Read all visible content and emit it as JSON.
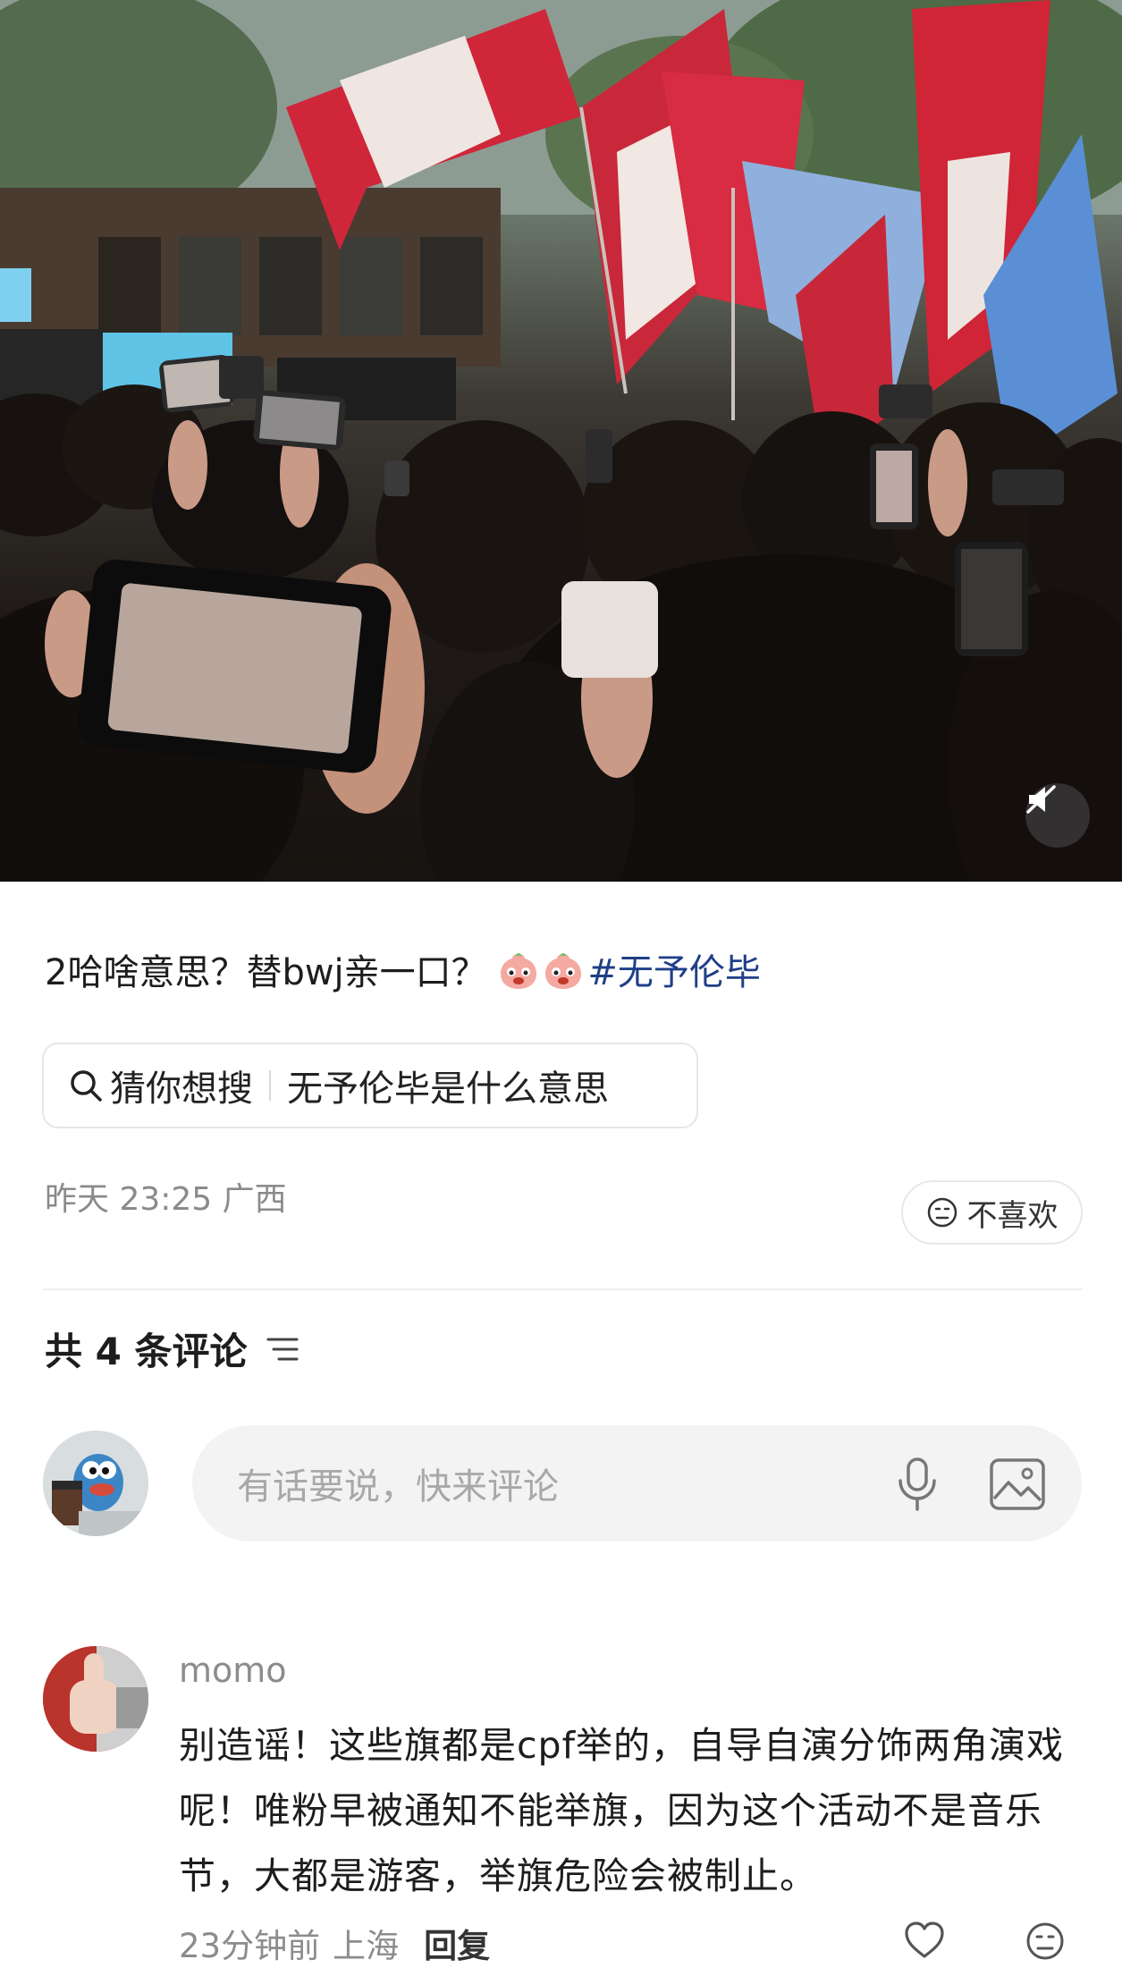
{
  "post": {
    "text_main": "2哈啥意思？替bwj亲一口？",
    "hashtag": "#无予伦毕",
    "emoji_icon": "crying-face-emoji",
    "search_prefix": "猜你想搜",
    "search_query": "无予伦毕是什么意思",
    "time": "昨天 23:25",
    "location": "广西",
    "dislike_label": "不喜欢"
  },
  "comments": {
    "count_label": "共 4 条评论",
    "input_placeholder": "有话要说，快来评论",
    "items": [
      {
        "user": "momo",
        "text": "别造谣！这些旗都是cpf举的，自导自演分饰两角演戏呢！唯粉早被通知不能举旗，因为这个活动不是音乐节，大都是游客，举旗危险会被制止。",
        "time": "23分钟前",
        "location": "上海",
        "reply_label": "回复"
      }
    ]
  },
  "colors": {
    "hashtag": "#1f3f87",
    "flag_red": "#d0263a",
    "flag_blue": "#5a8fd6"
  }
}
